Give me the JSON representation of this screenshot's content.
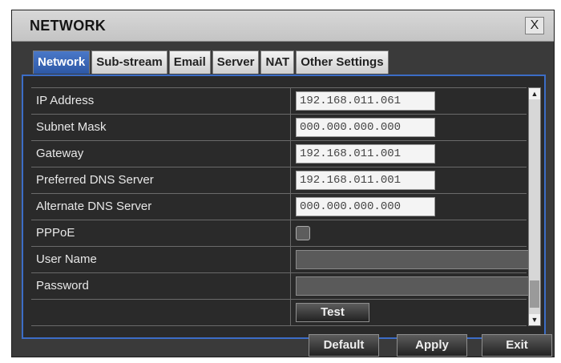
{
  "window": {
    "title": "NETWORK",
    "close_glyph": "X"
  },
  "tabs": [
    {
      "label": "Network",
      "active": true
    },
    {
      "label": "Sub-stream",
      "active": false
    },
    {
      "label": "Email",
      "active": false
    },
    {
      "label": "Server",
      "active": false
    },
    {
      "label": "NAT",
      "active": false
    },
    {
      "label": "Other Settings",
      "active": false
    }
  ],
  "fields": {
    "ip_address": {
      "label": "IP Address",
      "value": "192.168.011.061"
    },
    "subnet_mask": {
      "label": "Subnet Mask",
      "value": "000.000.000.000"
    },
    "gateway": {
      "label": "Gateway",
      "value": "192.168.011.001"
    },
    "preferred_dns": {
      "label": "Preferred DNS Server",
      "value": "192.168.011.001"
    },
    "alternate_dns": {
      "label": "Alternate DNS Server",
      "value": "000.000.000.000"
    },
    "pppoe": {
      "label": "PPPoE",
      "checked": false
    },
    "user_name": {
      "label": "User Name",
      "value": ""
    },
    "password": {
      "label": "Password",
      "value": ""
    }
  },
  "buttons": {
    "test": "Test",
    "default": "Default",
    "apply": "Apply",
    "exit": "Exit"
  },
  "colors": {
    "accent": "#3c6dc6",
    "active_tab": "#3b66b6",
    "panel": "#2a2a2a"
  }
}
